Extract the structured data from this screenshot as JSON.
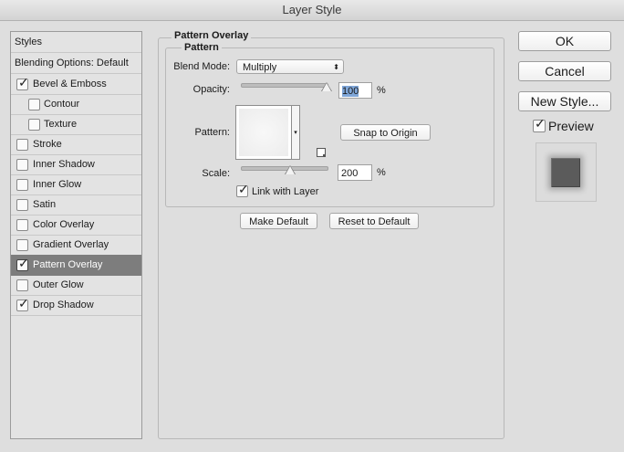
{
  "window": {
    "title": "Layer Style"
  },
  "sidebar": {
    "header": "Styles",
    "blending_options": "Blending Options: Default",
    "items": [
      {
        "label": "Bevel & Emboss",
        "checked": true
      },
      {
        "label": "Contour",
        "checked": false
      },
      {
        "label": "Texture",
        "checked": false
      },
      {
        "label": "Stroke",
        "checked": false
      },
      {
        "label": "Inner Shadow",
        "checked": false
      },
      {
        "label": "Inner Glow",
        "checked": false
      },
      {
        "label": "Satin",
        "checked": false
      },
      {
        "label": "Color Overlay",
        "checked": false
      },
      {
        "label": "Gradient Overlay",
        "checked": false
      },
      {
        "label": "Pattern Overlay",
        "checked": true,
        "selected": true
      },
      {
        "label": "Outer Glow",
        "checked": false
      },
      {
        "label": "Drop Shadow",
        "checked": true
      }
    ]
  },
  "panel": {
    "title": "Pattern Overlay",
    "group_title": "Pattern",
    "blend_mode": {
      "label": "Blend Mode:",
      "value": "Multiply"
    },
    "opacity": {
      "label": "Opacity:",
      "value": "100",
      "unit": "%",
      "level": 1.0
    },
    "pattern": {
      "label": "Pattern:",
      "snap_button": "Snap to Origin"
    },
    "scale": {
      "label": "Scale:",
      "value": "200",
      "unit": "%"
    },
    "link_with_layer": {
      "label": "Link with Layer",
      "checked": true
    },
    "make_default": "Make Default",
    "reset_default": "Reset to Default"
  },
  "buttons": {
    "ok": "OK",
    "cancel": "Cancel",
    "new_style": "New Style...",
    "preview": {
      "label": "Preview",
      "checked": true
    }
  },
  "icons": {
    "check": "✓",
    "select_arrows": "⬍",
    "dropdown_arrow": "▾",
    "new_preset": "new-preset-icon"
  },
  "colors": {
    "selected_row": "#7d7d7d",
    "preview_swatch": "#5b5b5b"
  }
}
